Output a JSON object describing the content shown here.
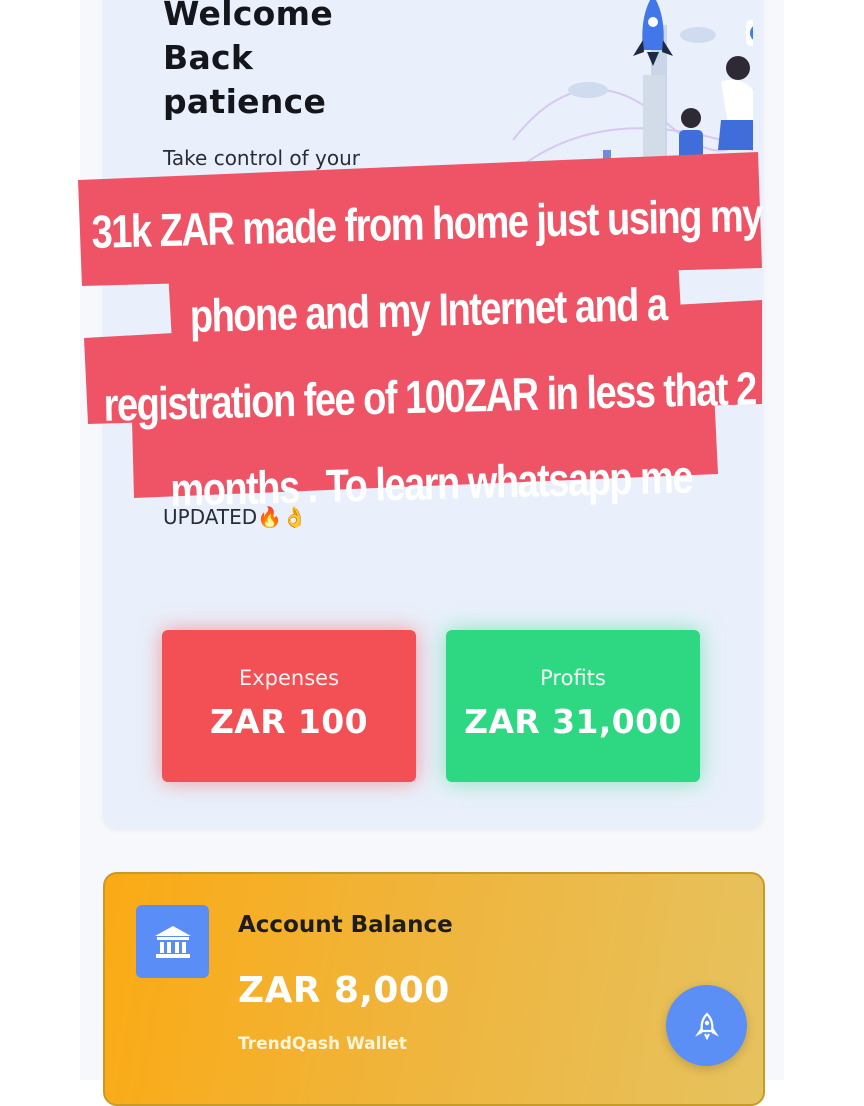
{
  "hero": {
    "welcome": "Welcome\nBack\npatience",
    "subtitle": "Take control of your",
    "updated": "UPDATED🔥👌"
  },
  "stats": {
    "expenses_label": "Expenses",
    "expenses_value": "ZAR 100",
    "profits_label": "Profits",
    "profits_value": "ZAR 31,000"
  },
  "balance": {
    "title": "Account Balance",
    "amount": "ZAR 8,000",
    "wallet": "TrendQash Wallet"
  },
  "overlay": {
    "text": "31k ZAR made from home just using my phone and my Internet and a registration fee of 100ZAR in less that 2 months . To learn whatsapp me"
  },
  "icons": {
    "bank": "bank-icon",
    "rocket": "rocket-icon"
  },
  "colors": {
    "expenses": "#f25055",
    "profits": "#2ed883",
    "balance_card": "#f5b02a",
    "accent": "#5b8df6",
    "overlay": "#ee5466"
  }
}
